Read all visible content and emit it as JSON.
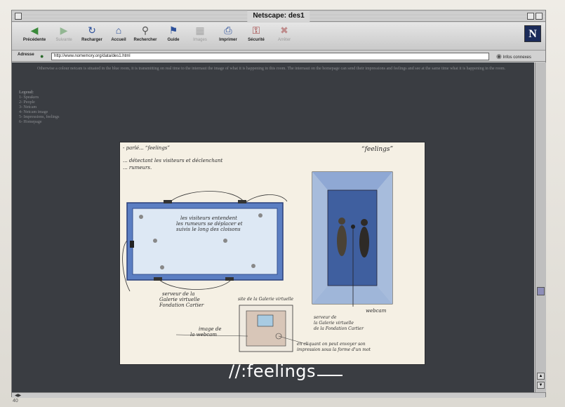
{
  "window": {
    "title": "Netscape: des1"
  },
  "toolbar": {
    "buttons": [
      {
        "label": "Précédente",
        "icon": "back-arrow-icon",
        "enabled": true
      },
      {
        "label": "Suivante",
        "icon": "forward-arrow-icon",
        "enabled": false
      },
      {
        "label": "Recharger",
        "icon": "reload-icon",
        "enabled": true
      },
      {
        "label": "Accueil",
        "icon": "home-icon",
        "enabled": true
      },
      {
        "label": "Rechercher",
        "icon": "search-icon",
        "enabled": true
      },
      {
        "label": "Guide",
        "icon": "guide-icon",
        "enabled": true
      },
      {
        "label": "Images",
        "icon": "images-icon",
        "enabled": false
      },
      {
        "label": "Imprimer",
        "icon": "print-icon",
        "enabled": true
      },
      {
        "label": "Sécurité",
        "icon": "security-icon",
        "enabled": true
      },
      {
        "label": "Arrêter",
        "icon": "stop-icon",
        "enabled": false
      }
    ],
    "logo": "N"
  },
  "location": {
    "label": "Adresse",
    "url": "http://www.nomemory.org/data/des1.html",
    "related_label": "Infos connexes"
  },
  "content": {
    "intro": "Otherwise a colour netcam is situated in the blue room, it is transmitting on real time to the internaut the image of what it is happening in this room. The internaut on the homepage can send their impressions and feelings and see at the same time what it is happening in the room.",
    "legend_title": "Legend:",
    "legend_items": [
      "1- Speakers",
      "2- People",
      "3- Netcam",
      "4- Netcam image",
      "5- Impressions, feelings",
      "6- Homepage"
    ],
    "sketch": {
      "note_top_1": "- parlé... “feelings”",
      "note_top_2": "... détectant les visiteurs et déclenchant",
      "note_top_3": "... rumeurs.",
      "title_right": "“feelings”",
      "room_note_1": "les visiteurs entendent",
      "room_note_2": "les rumeurs se déplacer et",
      "room_note_3": "suivis le long des cloisons",
      "server_note_1": "serveur de la",
      "server_note_2": "Galerie virtuelle",
      "server_note_3": "Fondation Cartier",
      "site_note": "site de la Galerie virtuelle",
      "image_note_1": "image de",
      "image_note_2": "la webcam",
      "webcam_note": "webcam",
      "server2_note_1": "serveur de",
      "server2_note_2": "la Galerie virtuelle",
      "server2_note_3": "de la Fondation Cartier",
      "send_note_1": "en cliquant on peut envoyer son",
      "send_note_2": "impression sous la forme d'un mot"
    }
  },
  "overlay": {
    "caption": "//:feelings"
  },
  "page_number": "40",
  "colors": {
    "content_bg": "#3a3d42",
    "sketch_paper": "#f5f0e4",
    "room_blue": "#5b7ec2",
    "caption": "#ffffff"
  }
}
